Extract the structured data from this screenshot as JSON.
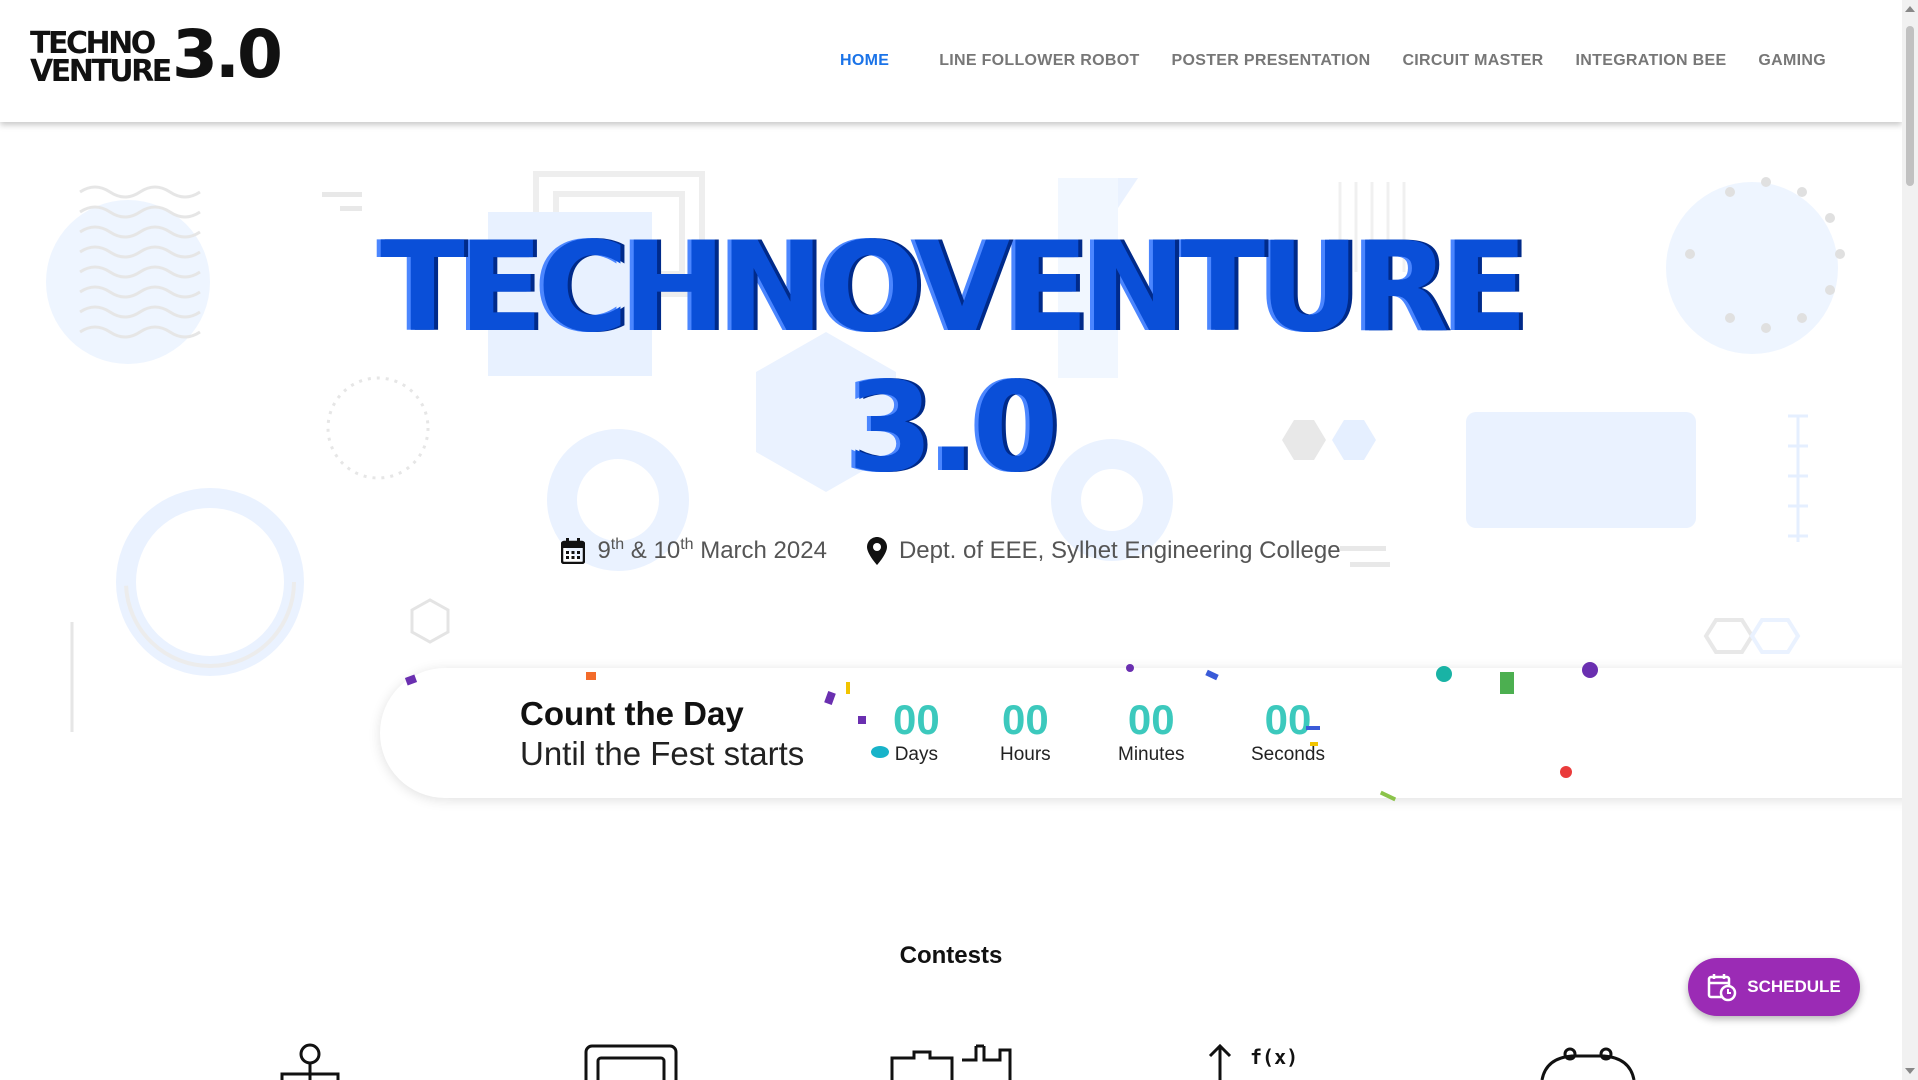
{
  "header": {
    "logo_line1": "TECHNO",
    "logo_line2": "VENTURE",
    "logo_version": "3.0",
    "nav": [
      {
        "label": "HOME",
        "active": true
      },
      {
        "label": "LINE FOLLOWER ROBOT"
      },
      {
        "label": "POSTER PRESENTATION"
      },
      {
        "label": "CIRCUIT MASTER"
      },
      {
        "label": "INTEGRATION BEE"
      },
      {
        "label": "GAMING"
      }
    ]
  },
  "hero": {
    "title": "TECHNOVENTURE",
    "version": "3.0",
    "date_day1": "9",
    "date_sup1": "th",
    "date_mid": " & 10",
    "date_sup2": "th",
    "date_tail": " March 2024",
    "location": "Dept. of EEE, Sylhet Engineering College"
  },
  "countdown": {
    "heading": "Count the Day",
    "subheading": "Until the Fest starts",
    "units": [
      {
        "value": "00",
        "label": "Days"
      },
      {
        "value": "00",
        "label": "Hours"
      },
      {
        "value": "00",
        "label": "Minutes"
      },
      {
        "value": "00",
        "label": "Seconds"
      }
    ]
  },
  "contests": {
    "heading": "Contests"
  },
  "fab": {
    "label": "SCHEDULE"
  },
  "colors": {
    "accent": "#1a73e8",
    "title_blue": "#0a4fd8",
    "count_teal": "#3cc9bd",
    "fab_purple": "#9b2bb5"
  }
}
